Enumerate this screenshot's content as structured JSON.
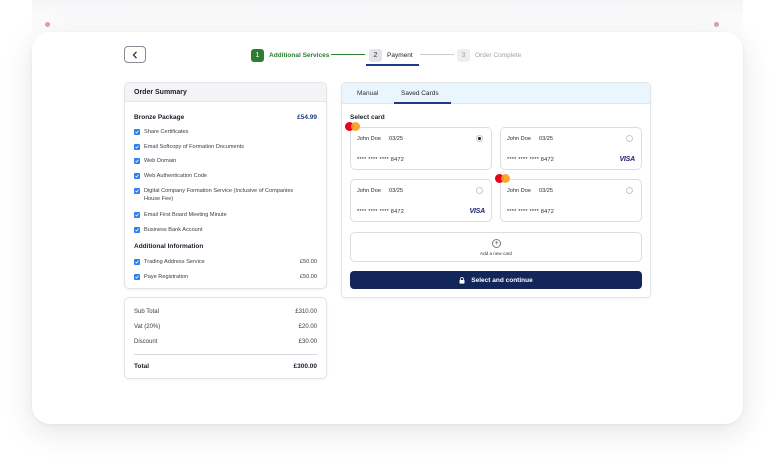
{
  "stepper": {
    "steps": [
      {
        "num": "1",
        "label": "Additional Services"
      },
      {
        "num": "2",
        "label": "Payment"
      },
      {
        "num": "3",
        "label": "Order Complete"
      }
    ]
  },
  "summary": {
    "title": "Order Summary",
    "package": {
      "name": "Bronze Package",
      "price": "£54.99"
    },
    "features": [
      "Share Certificates",
      "Email Softcopy of Formation Documents",
      "Web Domain",
      "Web Authentication Code",
      "Digital Company Formation Service (Inclusive of Companies House Fee)",
      "Email First Board Meeting Minute",
      "Business Bank Account"
    ],
    "additional_title": "Additional Information",
    "additional": [
      {
        "label": "Trading Address Service",
        "price": "£50.00"
      },
      {
        "label": "Paye Registration",
        "price": "£50.00"
      }
    ]
  },
  "totals": {
    "rows": [
      {
        "label": "Sub Total",
        "value": "£310.00"
      },
      {
        "label": "Vat (20%)",
        "value": "£20.00"
      },
      {
        "label": "Discount",
        "value": "£30.00"
      }
    ],
    "total_label": "Total",
    "total_value": "£300.00"
  },
  "payment": {
    "tabs": [
      "Manual",
      "Saved Cards"
    ],
    "active_tab": "Saved Cards",
    "select_label": "Select card",
    "cards": [
      {
        "name": "John Doe",
        "expiry": "03/25",
        "number": "**** **** **** 8472",
        "brand": "mastercard",
        "selected": true
      },
      {
        "name": "John Doe",
        "expiry": "03/25",
        "number": "**** **** **** 8472",
        "brand": "visa",
        "selected": false
      },
      {
        "name": "John Doe",
        "expiry": "03/25",
        "number": "**** **** **** 8472",
        "brand": "visa",
        "selected": false
      },
      {
        "name": "John Doe",
        "expiry": "03/25",
        "number": "**** **** **** 8472",
        "brand": "mastercard",
        "selected": false
      }
    ],
    "visa_text": "VISA",
    "add_card_label": "Add a new card",
    "submit_label": "Select and continue"
  },
  "colors": {
    "step_done": "#2e7d32",
    "primary": "#13265c",
    "tab_bg": "#eaf6fd",
    "check": "#2f80ed"
  }
}
